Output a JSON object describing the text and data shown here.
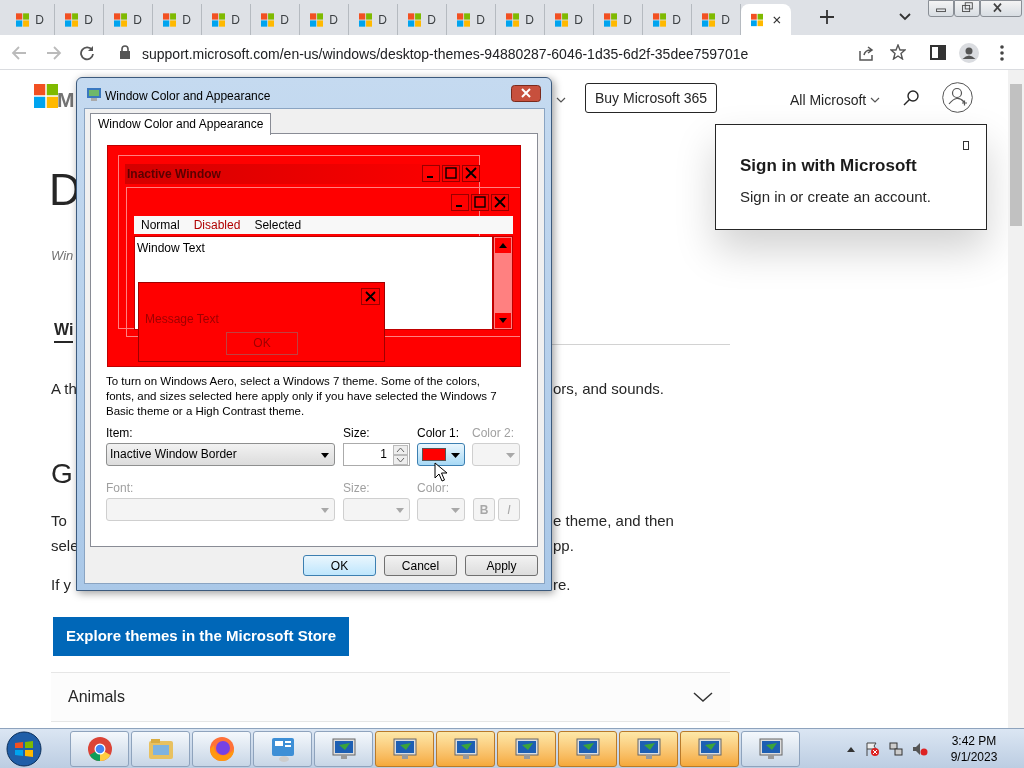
{
  "browser": {
    "tabs": [
      {
        "label": "D",
        "selected": false
      },
      {
        "label": "D",
        "selected": false
      },
      {
        "label": "D",
        "selected": false
      },
      {
        "label": "D",
        "selected": false
      },
      {
        "label": "D",
        "selected": false
      },
      {
        "label": "D",
        "selected": false
      },
      {
        "label": "D",
        "selected": false
      },
      {
        "label": "D",
        "selected": false
      },
      {
        "label": "D",
        "selected": false
      },
      {
        "label": "D",
        "selected": false
      },
      {
        "label": "D",
        "selected": false
      },
      {
        "label": "D",
        "selected": false
      },
      {
        "label": "D",
        "selected": false
      },
      {
        "label": "D",
        "selected": false
      },
      {
        "label": "D",
        "selected": false
      },
      {
        "selected": true
      }
    ],
    "url": "support.microsoft.com/en-us/windows/desktop-themes-94880287-6046-1d35-6d2f-35dee759701e"
  },
  "page": {
    "logo_text": "M",
    "buy_button": "Buy Microsoft 365",
    "all_microsoft": "All Microsoft",
    "sign_in_popup": {
      "title": "Sign in with Microsoft",
      "text": "Sign in or create an account."
    },
    "heading": "D",
    "subtitle": "Win",
    "tab": "Wi",
    "paragraphs": [
      {
        "left": "A th",
        "right": "ors, and sounds."
      },
      {
        "left": "To",
        "right": "e theme, and then"
      },
      {
        "left": "sele",
        "right": "pp."
      },
      {
        "left": "If y",
        "right": "re."
      }
    ],
    "section_heading": "G",
    "store_button": "Explore themes in the Microsoft Store",
    "accordion": [
      {
        "label": "Animals",
        "expanded": false
      }
    ]
  },
  "dialog": {
    "title": "Window Color and Appearance",
    "tab": "Window Color and Appearance",
    "preview": {
      "inactive_title": "Inactive Window",
      "menu": [
        {
          "label": "Normal",
          "kind": "normal"
        },
        {
          "label": "Disabled",
          "kind": "disabled"
        },
        {
          "label": "Selected",
          "kind": "selected"
        }
      ],
      "window_text": "Window Text",
      "message_text": "Message Text",
      "message_button": "OK"
    },
    "description": "To turn on Windows Aero, select a Windows 7 theme.  Some of the colors, fonts, and sizes selected here apply only if you have selected the Windows 7 Basic theme or a High Contrast theme.",
    "row1": [
      {
        "label": "Item:",
        "kind": "combo",
        "value": "Inactive Window Border",
        "disabled": false
      },
      {
        "label": "Size:",
        "kind": "spin",
        "value": "1",
        "disabled": false
      },
      {
        "label": "Color 1:",
        "kind": "color",
        "color": "#ff0000",
        "disabled": false
      },
      {
        "label": "Color 2:",
        "kind": "color",
        "disabled": true
      }
    ],
    "row2": [
      {
        "label": "Font:",
        "kind": "combo",
        "disabled": true
      },
      {
        "label": "Size:",
        "kind": "combo",
        "disabled": true
      },
      {
        "label": "Color:",
        "kind": "color",
        "disabled": true
      }
    ],
    "style_buttons": [
      {
        "label": "B",
        "disabled": true
      },
      {
        "label": "I",
        "disabled": true
      }
    ],
    "buttons": [
      {
        "label": "OK",
        "default": true
      },
      {
        "label": "Cancel",
        "default": false
      },
      {
        "label": "Apply",
        "default": false
      }
    ]
  },
  "taskbar": {
    "items": [
      {
        "kind": "chrome",
        "highlighted": false
      },
      {
        "kind": "folder",
        "highlighted": false
      },
      {
        "kind": "firefox",
        "highlighted": false
      },
      {
        "kind": "control",
        "highlighted": false
      },
      {
        "kind": "monitor",
        "highlighted": false
      },
      {
        "kind": "monitor",
        "highlighted": true
      },
      {
        "kind": "monitor",
        "highlighted": true
      },
      {
        "kind": "monitor",
        "highlighted": true
      },
      {
        "kind": "monitor",
        "highlighted": true
      },
      {
        "kind": "monitor",
        "highlighted": true
      },
      {
        "kind": "monitor",
        "highlighted": true
      },
      {
        "kind": "monitor",
        "highlighted": false
      }
    ],
    "time": "3:42 PM",
    "date": "9/1/2023"
  }
}
